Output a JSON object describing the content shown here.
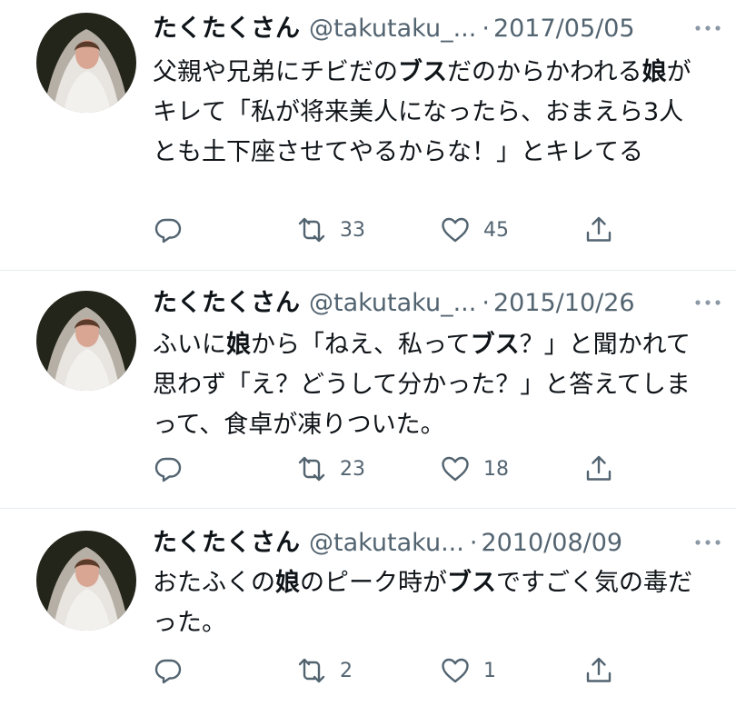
{
  "tweets": [
    {
      "name": "たくたくさん",
      "handle": "@takutaku_...",
      "sep": "·",
      "date": "2017/05/05",
      "body": [
        {
          "t": "父親や兄弟にチビだの",
          "b": false
        },
        {
          "t": "ブス",
          "b": true
        },
        {
          "t": "だのからかわれる",
          "b": false
        },
        {
          "t": "娘",
          "b": true
        },
        {
          "t": "がキレて「私が将来美人になったら、おまえら3人とも土下座させてやるからな！」とキレてる",
          "b": false
        }
      ],
      "replies": "",
      "retweets": "33",
      "likes": "45"
    },
    {
      "name": "たくたくさん",
      "handle": "@takutaku_...",
      "sep": "·",
      "date": "2015/10/26",
      "body": [
        {
          "t": "ふいに",
          "b": false
        },
        {
          "t": "娘",
          "b": true
        },
        {
          "t": "から「ねえ、私って",
          "b": false
        },
        {
          "t": "ブス",
          "b": true
        },
        {
          "t": "？」と聞かれて思わず「え？どうして分かった？」と答えてしまって、食卓が凍りついた。",
          "b": false
        }
      ],
      "replies": "",
      "retweets": "23",
      "likes": "18"
    },
    {
      "name": "たくたくさん",
      "handle": "@takutaku...",
      "sep": "·",
      "date": "2010/08/09",
      "body": [
        {
          "t": "おたふくの",
          "b": false
        },
        {
          "t": "娘",
          "b": true
        },
        {
          "t": "のピーク時が",
          "b": false
        },
        {
          "t": "ブス",
          "b": true
        },
        {
          "t": "ですごく気の毒だった。",
          "b": false
        }
      ],
      "replies": "",
      "retweets": "2",
      "likes": "1"
    }
  ],
  "icons": {
    "reply": "reply-icon",
    "retweet": "retweet-icon",
    "like": "heart-icon",
    "share": "share-icon",
    "more": "more-icon"
  },
  "colors": {
    "text": "#0f1419",
    "secondary": "#536471",
    "divider": "#e6ecf0"
  }
}
